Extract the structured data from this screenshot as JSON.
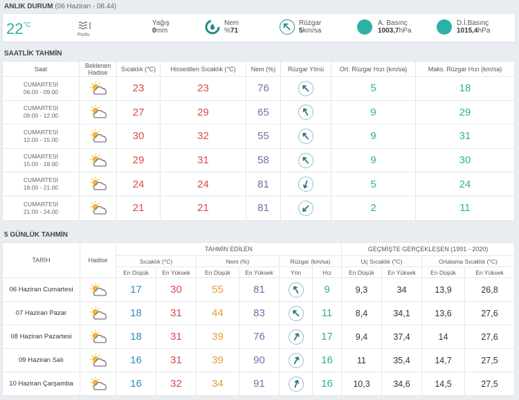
{
  "current": {
    "title": "ANLIK DURUM",
    "subtitle": "(06 Haziran - 08.44)",
    "temp": "22",
    "temp_unit": "°C",
    "condition": "Puslu",
    "rain_label": "Yağış",
    "rain_value": "0",
    "rain_unit": "mm",
    "humidity_label": "Nem",
    "humidity_prefix": "%",
    "humidity_value": "71",
    "wind_label": "Rüzgar",
    "wind_value": "5",
    "wind_unit": "km/sa",
    "pressure_label": "A. Basınç",
    "pressure_value": "1003,7",
    "pressure_unit": "hPa",
    "sea_pressure_label": "D.İ.Basınç",
    "sea_pressure_value": "1015,4",
    "sea_pressure_unit": "hPa"
  },
  "hourly": {
    "title": "SAATLİK TAHMİN",
    "headers": {
      "saat": "Saat",
      "hadise_1": "Beklenen",
      "hadise_2": "Hadise",
      "temp": "Sıcaklık (°C)",
      "feels": "Hissedilen Sıcaklık (°C)",
      "humidity": "Nem (%)",
      "wind_dir": "Rüzgar Yönü",
      "avg_wind": "Ort. Rüzgar Hızı (km/sa)",
      "max_wind": "Maks. Rüzgar Hızı (km/sa)"
    },
    "rows": [
      {
        "day": "CUMARTESİ",
        "time": "06.00 - 09.00",
        "icon": "partly-cloudy-icon",
        "temp": "23",
        "feels": "23",
        "humidity": "76",
        "wind_angle": 135,
        "avg": "5",
        "max": "18"
      },
      {
        "day": "CUMARTESİ",
        "time": "09.00 - 12.00",
        "icon": "partly-cloudy-icon",
        "temp": "27",
        "feels": "29",
        "humidity": "65",
        "wind_angle": 150,
        "avg": "9",
        "max": "29"
      },
      {
        "day": "CUMARTESİ",
        "time": "12.00 - 15.00",
        "icon": "partly-cloudy-icon",
        "temp": "30",
        "feels": "32",
        "humidity": "55",
        "wind_angle": 140,
        "avg": "9",
        "max": "31"
      },
      {
        "day": "CUMARTESİ",
        "time": "15.00 - 18.00",
        "icon": "partly-cloudy-icon",
        "temp": "29",
        "feels": "31",
        "humidity": "58",
        "wind_angle": 140,
        "avg": "9",
        "max": "30"
      },
      {
        "day": "CUMARTESİ",
        "time": "18.00 - 21.00",
        "icon": "partly-cloudy-icon",
        "temp": "24",
        "feels": "24",
        "humidity": "81",
        "wind_angle": 20,
        "avg": "5",
        "max": "24"
      },
      {
        "day": "CUMARTESİ",
        "time": "21.00 - 24.00",
        "icon": "partly-cloudy-icon",
        "temp": "21",
        "feels": "21",
        "humidity": "81",
        "wind_angle": 45,
        "avg": "2",
        "max": "11"
      }
    ]
  },
  "daily": {
    "title": "5 GÜNLÜK TAHMİN",
    "headers": {
      "tarih": "TARİH",
      "hadise": "Hadise",
      "forecast": "TAHMİN EDİLEN",
      "history": "GEÇMİŞTE GERÇEKLEŞEN (1991 - 2020)",
      "temp": "Sıcaklık (°C)",
      "humidity": "Nem (%)",
      "wind": "Rüzgar (km/sa)",
      "extreme": "Uç Sıcaklık (°C)",
      "average": "Ortalama Sıcaklık (°C)",
      "low": "En Düşük",
      "high": "En Yüksek",
      "dir": "Yön",
      "speed": "Hız"
    },
    "rows": [
      {
        "date": "06 Haziran Cumartesi",
        "icon": "partly-cloudy-icon",
        "tmin": "17",
        "tmax": "30",
        "hmin": "55",
        "hmax": "81",
        "wind_angle": 150,
        "wspd": "9",
        "xmin": "9,3",
        "xmax": "34",
        "amin": "13,9",
        "amax": "26,8"
      },
      {
        "date": "07 Haziran Pazar",
        "icon": "partly-cloudy-icon",
        "tmin": "18",
        "tmax": "31",
        "hmin": "44",
        "hmax": "83",
        "wind_angle": 135,
        "wspd": "11",
        "xmin": "8,4",
        "xmax": "34,1",
        "amin": "13,6",
        "amax": "27,6"
      },
      {
        "date": "08 Haziran Pazartesi",
        "icon": "partly-cloudy-icon",
        "tmin": "18",
        "tmax": "31",
        "hmin": "39",
        "hmax": "76",
        "wind_angle": 210,
        "wspd": "17",
        "xmin": "9,4",
        "xmax": "37,4",
        "amin": "14",
        "amax": "27,6"
      },
      {
        "date": "09 Haziran Salı",
        "icon": "partly-cloudy-icon",
        "tmin": "16",
        "tmax": "31",
        "hmin": "39",
        "hmax": "90",
        "wind_angle": 210,
        "wspd": "16",
        "xmin": "11",
        "xmax": "35,4",
        "amin": "14,7",
        "amax": "27,5"
      },
      {
        "date": "10 Haziran Çarşamba",
        "icon": "partly-cloudy-icon",
        "tmin": "16",
        "tmax": "32",
        "hmin": "34",
        "hmax": "91",
        "wind_angle": 200,
        "wspd": "16",
        "xmin": "10,3",
        "xmax": "34,6",
        "amin": "14,5",
        "amax": "27,5"
      }
    ]
  },
  "colors": {
    "accent": "#2cb1a6",
    "red": "#d94a4a",
    "purple": "#7a6aa8",
    "green": "#2fb193",
    "blue": "#2a8fc0",
    "orange": "#e89a3a"
  }
}
